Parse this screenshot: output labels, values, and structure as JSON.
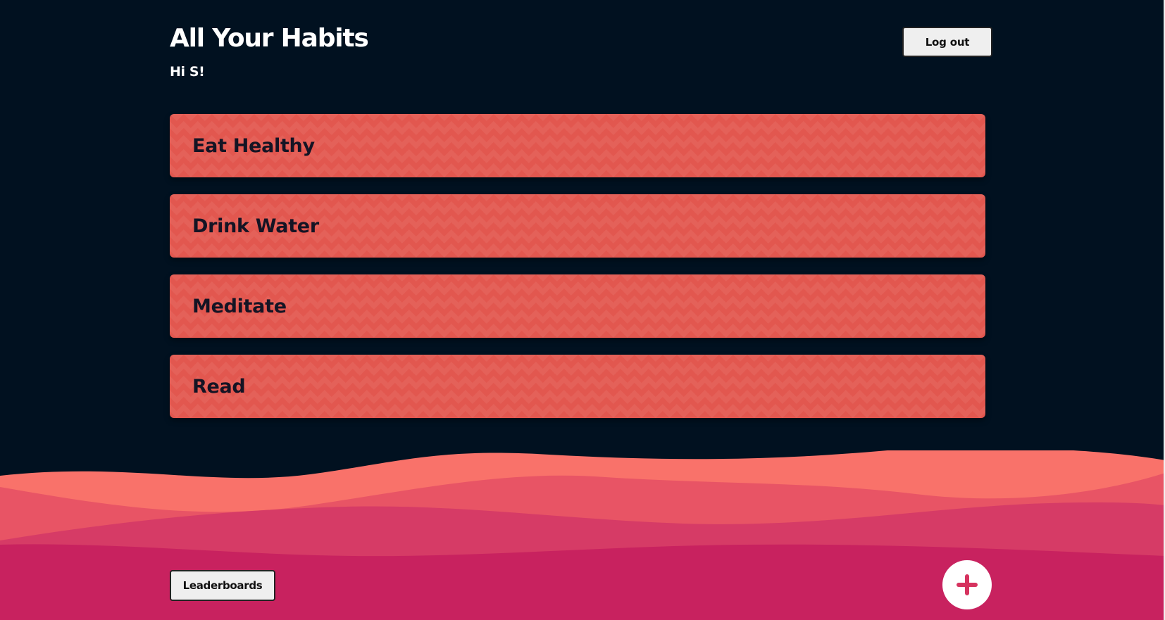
{
  "header": {
    "title": "All Your Habits",
    "greeting": "Hi S!",
    "logout_label": "Log out"
  },
  "habits": [
    {
      "name": "Eat Healthy"
    },
    {
      "name": "Drink Water"
    },
    {
      "name": "Meditate"
    },
    {
      "name": "Read"
    }
  ],
  "footer": {
    "leaderboards_label": "Leaderboards",
    "add_icon": "plus-icon"
  },
  "colors": {
    "background": "#011120",
    "habit_card": "#e2574f",
    "wave_1": "#f9726a",
    "wave_2": "#e85465",
    "wave_3": "#d63b66",
    "wave_4": "#c8225f",
    "accent": "#d6335f"
  }
}
